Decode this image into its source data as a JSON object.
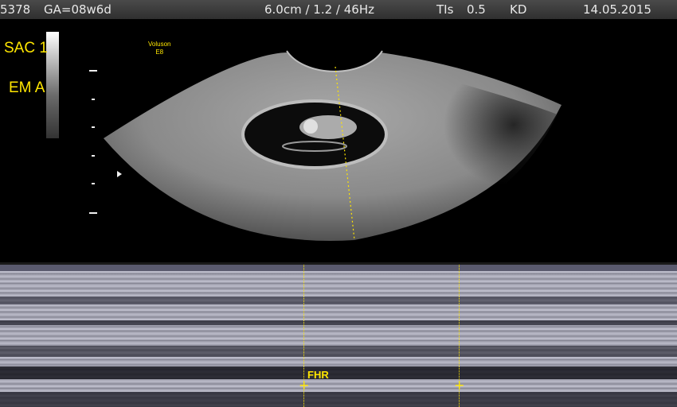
{
  "header": {
    "patient_id": "5378",
    "gestational_age": "GA=08w6d",
    "depth_freq": "6.0cm / 1.2 / 46Hz",
    "tis_label": "TIs",
    "tis_value": "0.5",
    "operator": "KD",
    "date": "14.05.2015"
  },
  "bmode": {
    "label_sac": "SAC 1",
    "label_em": "EM A",
    "probe_name": "Voluson",
    "probe_model": "E8"
  },
  "mmode": {
    "fhr_label": "FHR"
  },
  "colors": {
    "annotation": "#ffe600",
    "topbar": "#3a3a3a"
  }
}
